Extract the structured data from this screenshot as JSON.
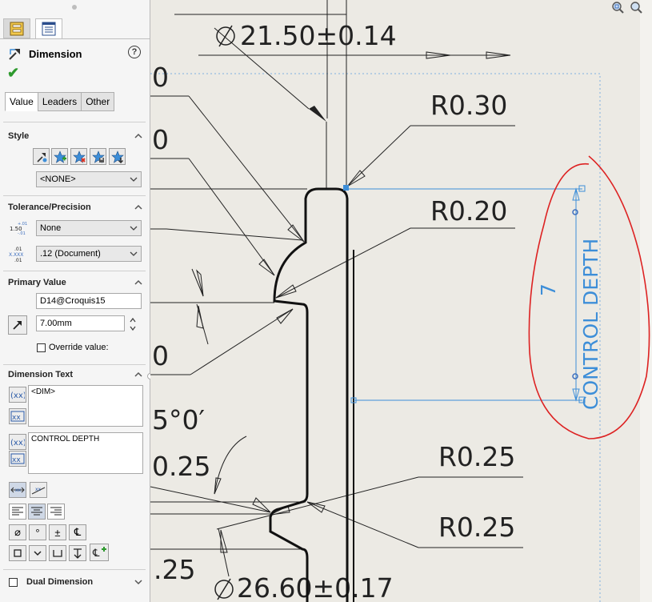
{
  "panel": {
    "title": "Dimension",
    "help_label": "?",
    "tabs": [
      {
        "icon": "dimxpert-icon",
        "selected": false
      },
      {
        "icon": "property-manager-icon",
        "selected": true
      }
    ],
    "subtabs": [
      "Value",
      "Leaders",
      "Other"
    ],
    "active_subtab": "Value"
  },
  "style": {
    "header": "Style",
    "tool_icons": [
      "apply-defaults-icon",
      "add-style-icon",
      "delete-style-icon",
      "save-style-icon",
      "load-style-icon"
    ],
    "selected_style": "<NONE>"
  },
  "tolerance": {
    "header": "Tolerance/Precision",
    "tolerance_type": "None",
    "precision": ".12 (Document)"
  },
  "primary_value": {
    "header": "Primary Value",
    "name": "D14@Croquis15",
    "value": "7.00mm",
    "override_label": "Override value:",
    "override_checked": false
  },
  "dimension_text": {
    "header": "Dimension Text",
    "text_upper": "<DIM>",
    "text_lower": "CONTROL DEPTH",
    "symbols": [
      "⌀",
      "°",
      "±",
      "℄"
    ],
    "extra_icons": [
      "box-icon",
      "chevron-down-icon",
      "counterbore-icon",
      "countersink-icon",
      "add-symbol-icon"
    ]
  },
  "dual_dimension": {
    "label": "Dual Dimension",
    "checked": false
  },
  "drawing": {
    "dimensions": [
      "21.50±0.14",
      "R0.30",
      "R0.20",
      "R0.25",
      "R0.25",
      "26.60±0.17"
    ],
    "cut_labels": [
      "0",
      "0",
      "0",
      "5°0′",
      "0.25",
      ".25"
    ],
    "selected_dimension_value": "7",
    "selected_dimension_text": "CONTROL DEPTH",
    "annotation_color": "#dd2222",
    "selection_color": "#3d8ed8"
  }
}
